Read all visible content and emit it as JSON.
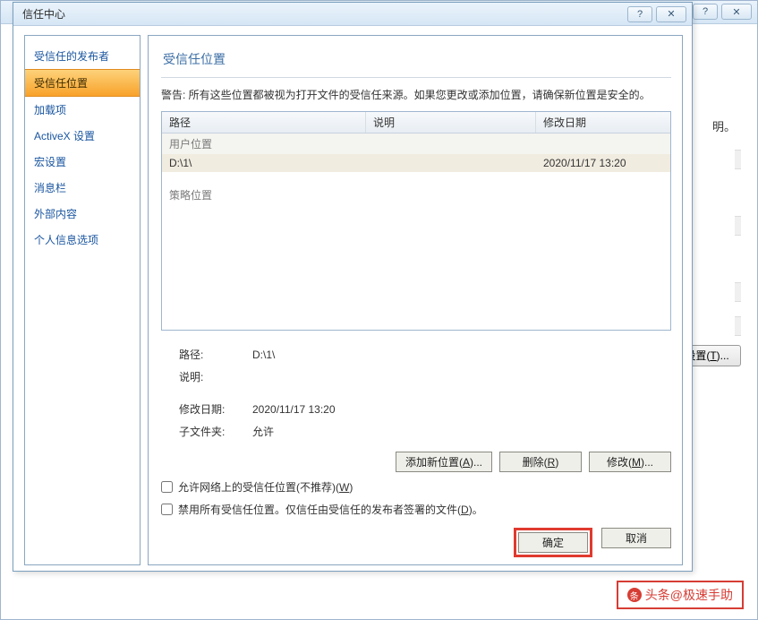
{
  "bg": {
    "text_fragment": "明。",
    "button_label": "设置",
    "button_accel": "T"
  },
  "dialog": {
    "title": "信任中心"
  },
  "sidebar": {
    "items": [
      {
        "label": "受信任的发布者"
      },
      {
        "label": "受信任位置"
      },
      {
        "label": "加载项"
      },
      {
        "label": "ActiveX 设置"
      },
      {
        "label": "宏设置"
      },
      {
        "label": "消息栏"
      },
      {
        "label": "外部内容"
      },
      {
        "label": "个人信息选项"
      }
    ],
    "selected_index": 1
  },
  "panel": {
    "heading": "受信任位置",
    "warning": "警告: 所有这些位置都被视为打开文件的受信任来源。如果您更改或添加位置，请确保新位置是安全的。",
    "columns": {
      "path": "路径",
      "desc": "说明",
      "date": "修改日期"
    },
    "groups": [
      {
        "name": "用户位置",
        "rows": [
          {
            "path": "D:\\1\\",
            "desc": "",
            "date": "2020/11/17 13:20"
          }
        ]
      },
      {
        "name": "策略位置",
        "rows": []
      }
    ],
    "details": {
      "path_label": "路径:",
      "path_value": "D:\\1\\",
      "desc_label": "说明:",
      "desc_value": "",
      "date_label": "修改日期:",
      "date_value": "2020/11/17 13:20",
      "sub_label": "子文件夹:",
      "sub_value": "允许"
    },
    "buttons": {
      "add": "添加新位置",
      "add_accel": "A",
      "remove": "删除",
      "remove_accel": "R",
      "modify": "修改",
      "modify_accel": "M"
    },
    "checks": {
      "allow_network": "允许网络上的受信任位置(不推荐)",
      "allow_network_accel": "W",
      "disable_all": "禁用所有受信任位置。仅信任由受信任的发布者签署的文件",
      "disable_all_accel": "D"
    }
  },
  "footer": {
    "ok": "确定",
    "cancel": "取消"
  },
  "watermark": {
    "text": "头条@极速手助"
  }
}
